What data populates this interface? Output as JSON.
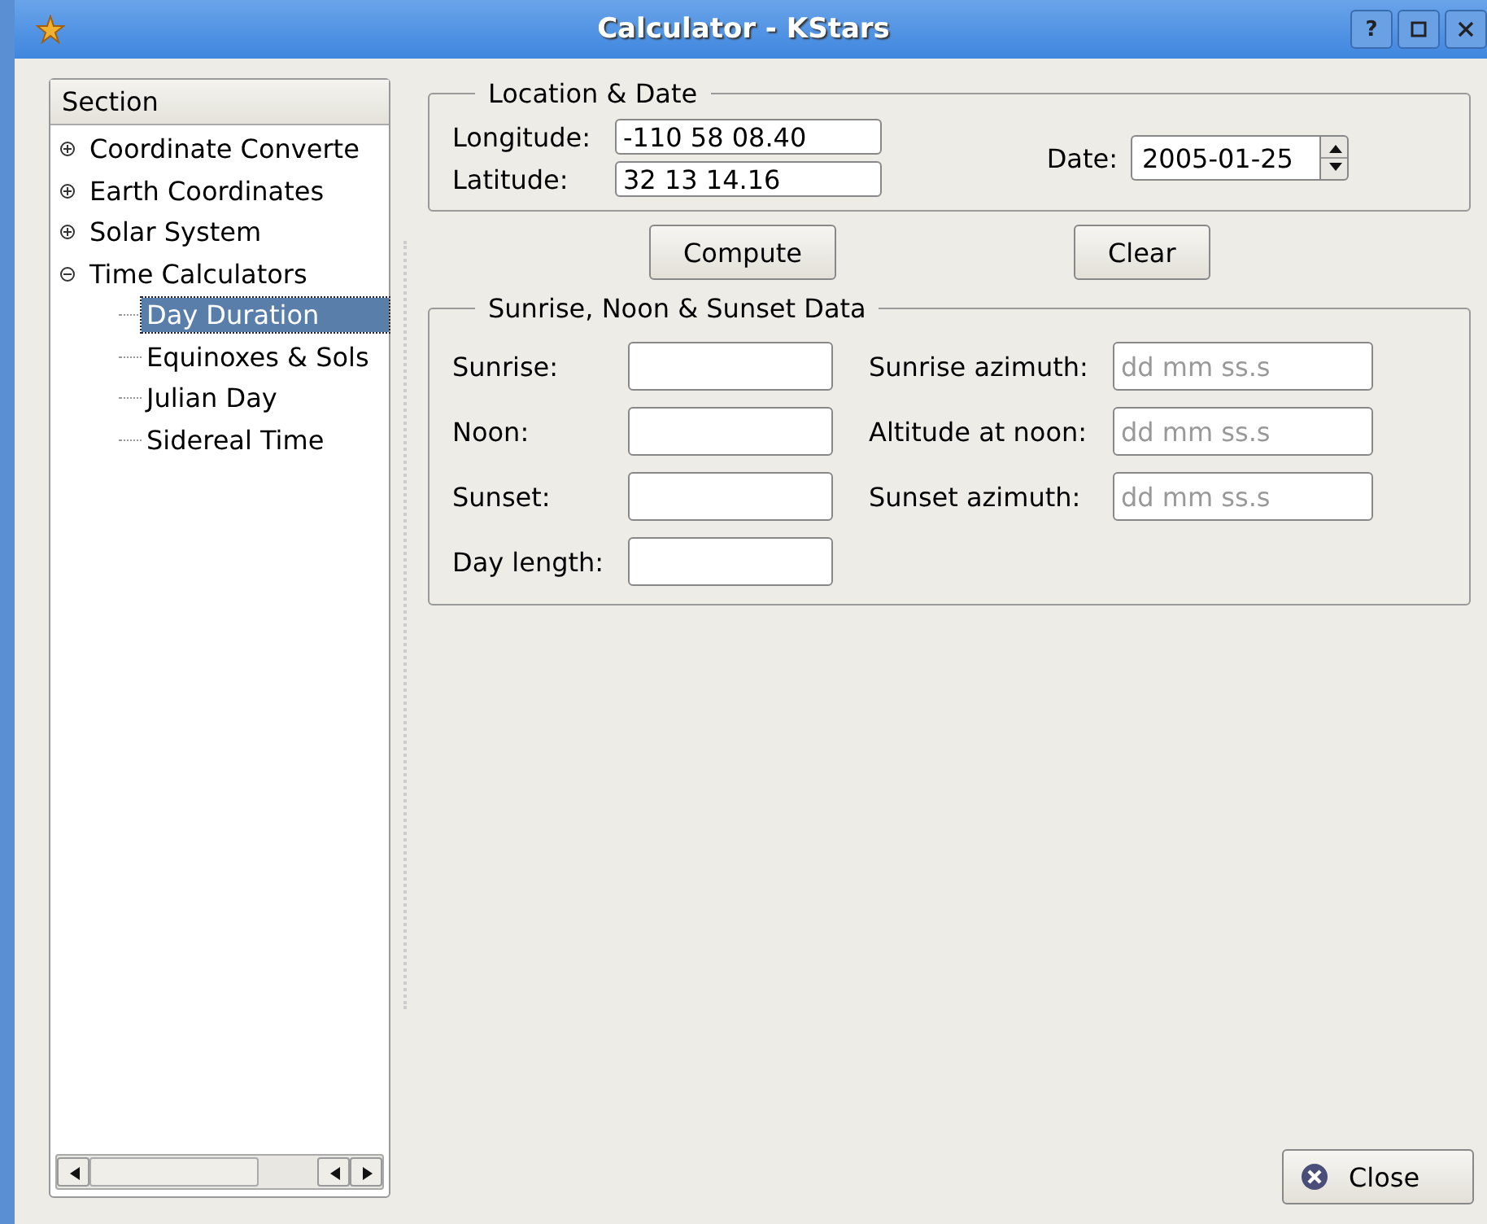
{
  "window": {
    "title": "Calculator - KStars",
    "buttons": [
      {
        "kind": "help",
        "label": "?"
      }
    ]
  },
  "tree": {
    "header": "Section",
    "items": [
      {
        "label": "Coordinate Converte",
        "expanded": false,
        "selected": false
      },
      {
        "label": "Earth Coordinates",
        "expanded": false,
        "selected": false
      },
      {
        "label": "Solar System",
        "expanded": false,
        "selected": false
      },
      {
        "label": "Time Calculators",
        "expanded": true,
        "selected": false,
        "children": [
          {
            "label": "Day Duration",
            "selected": true
          },
          {
            "label": "Equinoxes & Sols",
            "selected": false
          },
          {
            "label": "Julian Day",
            "selected": false
          },
          {
            "label": "Sidereal Time",
            "selected": false
          }
        ]
      }
    ]
  },
  "location": {
    "title": "Location & Date",
    "longitude_label": "Longitude:",
    "longitude": "-110 58 08.40",
    "latitude_label": "Latitude:",
    "latitude": "32 13 14.16",
    "date_label": "Date:",
    "date": "2005-01-25"
  },
  "actions": [
    "Compute",
    "Clear"
  ],
  "results": {
    "title": "Sunrise, Noon & Sunset Data",
    "left": [
      {
        "label": "Sunrise:"
      },
      {
        "label": "Noon:"
      },
      {
        "label": "Sunset:"
      },
      {
        "label": "Day length:"
      }
    ],
    "right": [
      {
        "label": "Sunrise azimuth:",
        "placeholder": "dd mm ss.s"
      },
      {
        "label": "Altitude at noon:",
        "placeholder": "dd mm ss.s"
      },
      {
        "label": "Sunset azimuth:",
        "placeholder": "dd mm ss.s"
      }
    ]
  },
  "close_button": "Close"
}
